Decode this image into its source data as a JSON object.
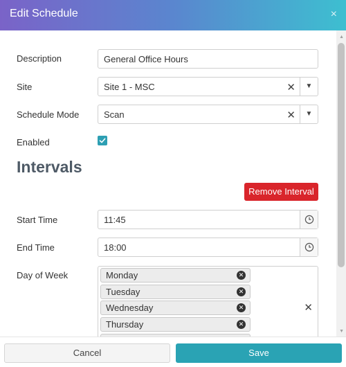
{
  "dialog": {
    "title": "Edit Schedule",
    "close_glyph": "×"
  },
  "form": {
    "description": {
      "label": "Description",
      "value": "General Office Hours"
    },
    "site": {
      "label": "Site",
      "value": "Site 1 - MSC"
    },
    "schedule_mode": {
      "label": "Schedule Mode",
      "value": "Scan"
    },
    "enabled": {
      "label": "Enabled",
      "checked": true
    }
  },
  "intervals": {
    "heading": "Intervals",
    "remove_button": "Remove Interval",
    "start_time": {
      "label": "Start Time",
      "value": "11:45"
    },
    "end_time": {
      "label": "End Time",
      "value": "18:00"
    },
    "day_of_week": {
      "label": "Day of Week",
      "selected": [
        "Monday",
        "Tuesday",
        "Wednesday",
        "Thursday"
      ]
    }
  },
  "footer": {
    "cancel_label": "Cancel",
    "save_label": "Save"
  },
  "icons": {
    "close": "close-icon",
    "clear": "clear-icon",
    "dropdown": "chevron-down-icon",
    "clock": "clock-icon",
    "check": "check-icon",
    "remove_chip": "remove-circle-icon"
  },
  "colors": {
    "header_gradient_start": "#7a63c8",
    "header_gradient_end": "#3dbfd0",
    "danger": "#d9252b",
    "primary": "#2aa3b4",
    "checkbox": "#2d9fb3",
    "heading": "#4e5a66"
  }
}
